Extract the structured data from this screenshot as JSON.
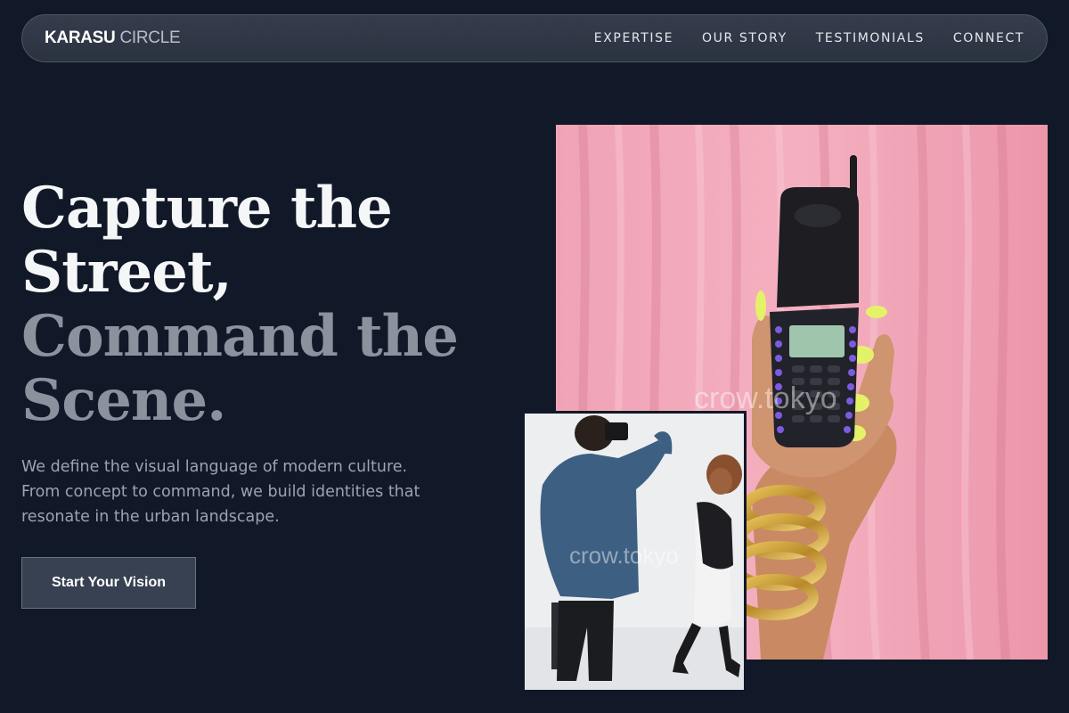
{
  "nav": {
    "brand_primary": "KARASU",
    "brand_secondary": "CIRCLE",
    "links": [
      {
        "label": "EXPERTISE"
      },
      {
        "label": "OUR STORY"
      },
      {
        "label": "TESTIMONIALS"
      },
      {
        "label": "CONNECT"
      }
    ]
  },
  "hero": {
    "headline_line1": "Capture the",
    "headline_line2": "Street,",
    "headline_line3": "Command the",
    "headline_line4": "Scene.",
    "description": "We define the visual language of modern culture. From concept to command, we build identities that resonate in the urban landscape.",
    "cta_label": "Start Your Vision"
  },
  "images": {
    "main_watermark": "crow.tokyo",
    "small_watermark": "crow.tokyo"
  },
  "colors": {
    "background": "#111827",
    "nav_bg": "#2f3745",
    "cta_bg": "#374151",
    "accent_pink": "#f2a5b8",
    "muted_text": "#8b919d"
  }
}
